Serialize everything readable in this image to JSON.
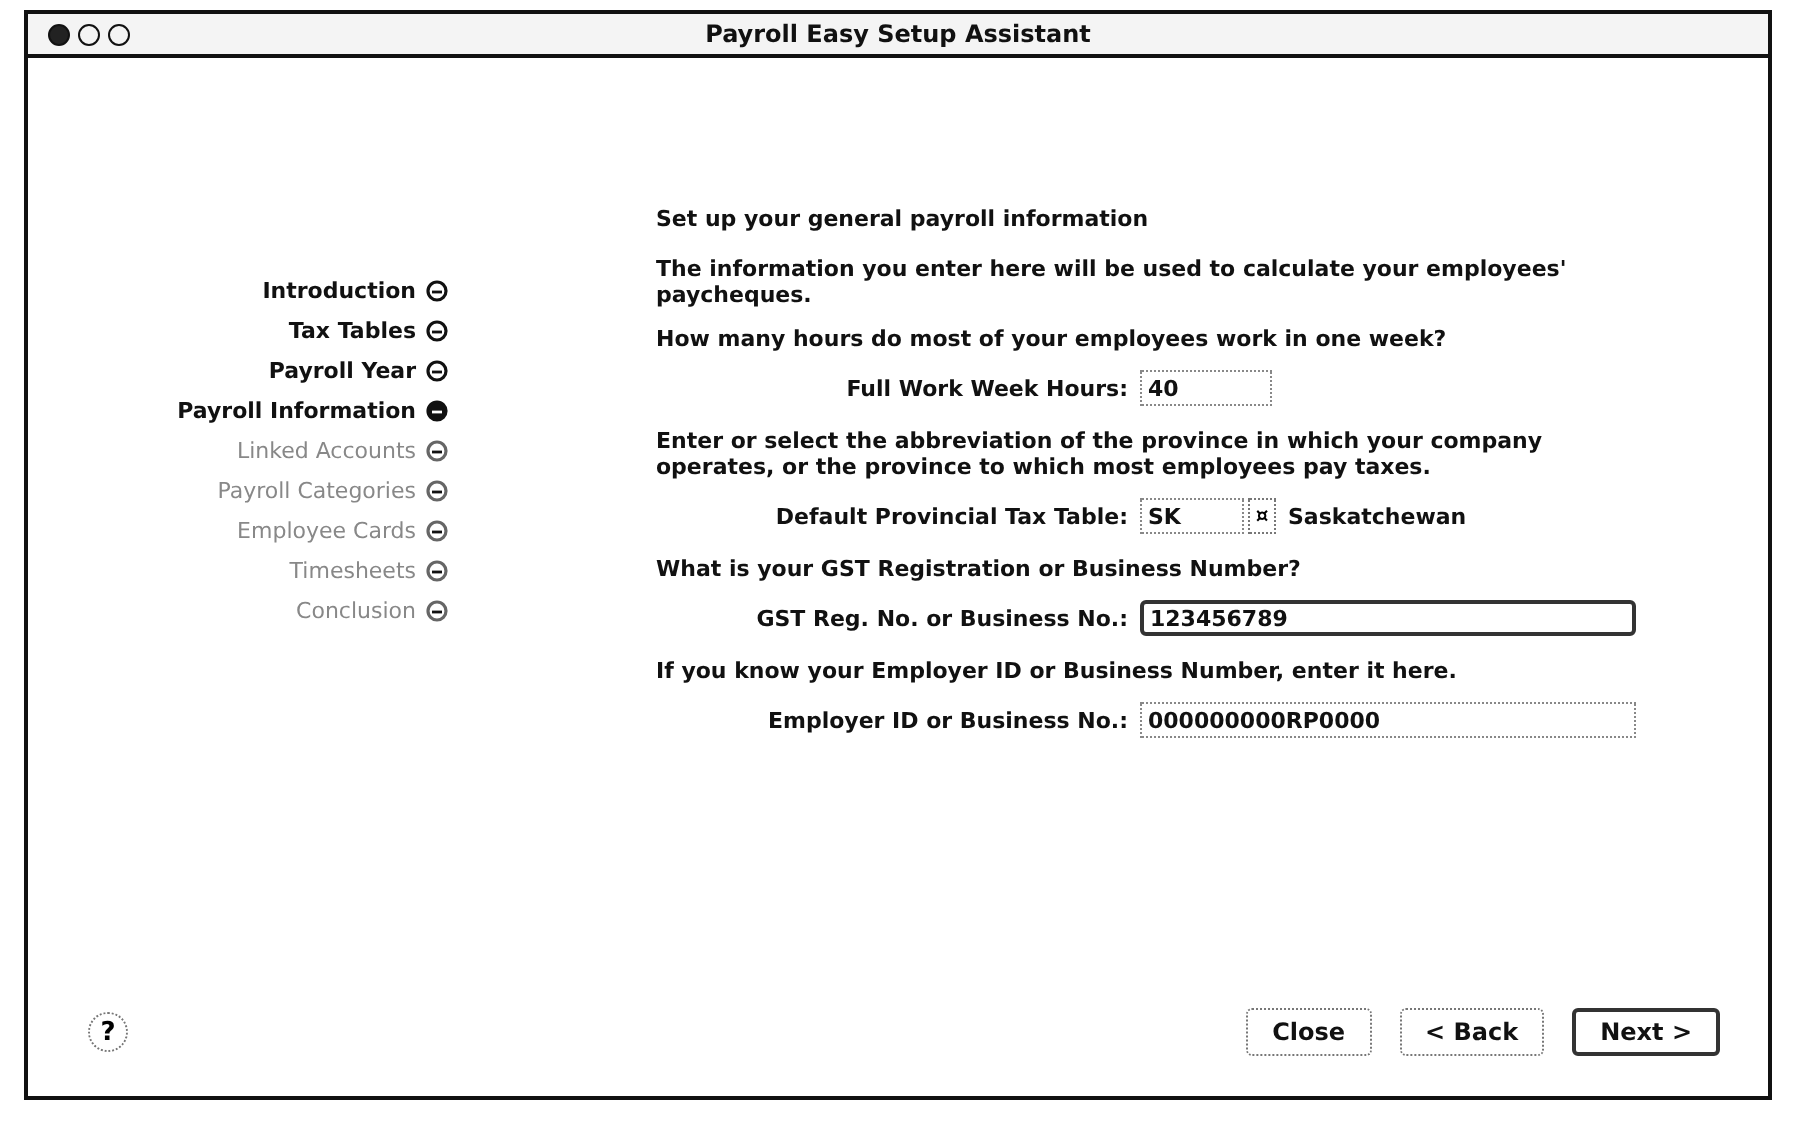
{
  "window": {
    "title": "Payroll Easy Setup Assistant"
  },
  "sidebar": {
    "items": [
      {
        "label": "Introduction",
        "selected": false,
        "disabled": false
      },
      {
        "label": "Tax Tables",
        "selected": false,
        "disabled": false
      },
      {
        "label": "Payroll Year",
        "selected": false,
        "disabled": false
      },
      {
        "label": "Payroll Information",
        "selected": true,
        "disabled": false
      },
      {
        "label": "Linked Accounts",
        "selected": false,
        "disabled": true
      },
      {
        "label": "Payroll Categories",
        "selected": false,
        "disabled": true
      },
      {
        "label": "Employee Cards",
        "selected": false,
        "disabled": true
      },
      {
        "label": "Timesheets",
        "selected": false,
        "disabled": true
      },
      {
        "label": "Conclusion",
        "selected": false,
        "disabled": true
      }
    ]
  },
  "content": {
    "heading": "Set up your general payroll information",
    "sections": [
      {
        "kind": "text",
        "text": "The information you enter here will be used to calculate your employees' paycheques."
      },
      {
        "kind": "text",
        "text": "How many hours do most of your employees work in one week?"
      },
      {
        "kind": "number",
        "label": "Full Work Week Hours:",
        "value": "40"
      },
      {
        "kind": "text",
        "text": "Enter or select the abbreviation of the province in which your company operates, or the province to which most employees pay taxes."
      },
      {
        "kind": "select",
        "label": "Default Provincial Tax Table:",
        "value": "SK",
        "button": "¤",
        "detail": "Saskatchewan"
      },
      {
        "kind": "text",
        "text": "What is your GST Registration or Business Number?"
      },
      {
        "kind": "field",
        "label": "GST Reg. No. or Business No.:",
        "value": "123456789",
        "focused": true
      },
      {
        "kind": "text",
        "text": "If you know your Employer ID or Business Number, enter it here."
      },
      {
        "kind": "field",
        "label": "Employer ID or Business No.:",
        "value": "000000000RP0000",
        "focused": false
      }
    ]
  },
  "footer": {
    "help": "?",
    "buttons": [
      {
        "label": "Close",
        "default": false
      },
      {
        "label": "< Back",
        "default": false
      },
      {
        "label": "Next >",
        "default": true
      }
    ]
  }
}
